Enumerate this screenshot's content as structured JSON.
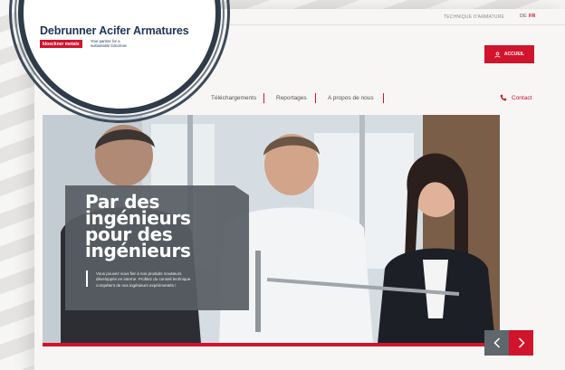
{
  "logo": {
    "title": "Debrunner Acifer Armatures",
    "kloeckner": "kloeckner metals",
    "tagline_1": "Your partner for a",
    "tagline_2": "sustainable tomorrow"
  },
  "topbar": {
    "link": "TECHNIQUE D'ARMATURE",
    "lang_de": "DE",
    "lang_fr": "FR"
  },
  "account": {
    "label": "ACCUEIL"
  },
  "nav": {
    "items": [
      {
        "label": "Téléchargements"
      },
      {
        "label": "Reportages"
      },
      {
        "label": "A propos de nous"
      }
    ],
    "contact": "Contact"
  },
  "hero": {
    "headline": [
      "Par des",
      "ingénieurs",
      "pour des",
      "ingénieurs"
    ],
    "text_lines": [
      "Vous pouvez vous fier à nos produits novateurs",
      "développés en interne. Profitez du conseil technique",
      "compétent de nos ingénieurs expérimentés !"
    ]
  },
  "colors": {
    "brand_red": "#d0142c",
    "brand_navy": "#1d3557",
    "overlay_gray": "#585e64"
  }
}
